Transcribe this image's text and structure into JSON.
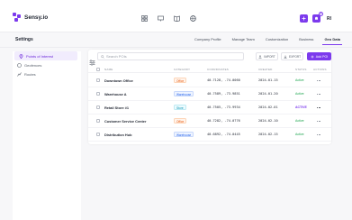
{
  "app": {
    "name": "Sensy.io"
  },
  "colors": {
    "accent": "#7c3aed",
    "office": "#ea580c",
    "warehouse": "#2563eb",
    "store": "#0891b2",
    "active": "#16a34a"
  },
  "topbar": {
    "icons": [
      "grid-icon",
      "monitor-icon",
      "book-icon",
      "globe-icon"
    ],
    "notification_count": "1",
    "avatar_initials": "RI"
  },
  "page": {
    "title": "Settings"
  },
  "tabs": [
    {
      "label": "Company Profile",
      "active": false
    },
    {
      "label": "Manage Team",
      "active": false
    },
    {
      "label": "Customization",
      "active": false
    },
    {
      "label": "Business",
      "active": false
    },
    {
      "label": "Geo Data",
      "active": true
    }
  ],
  "sidebar": {
    "items": [
      {
        "label": "Points of Interest",
        "icon": "map-pin-icon",
        "active": true
      },
      {
        "label": "Geofences",
        "icon": "geofence-icon",
        "active": false
      },
      {
        "label": "Routes",
        "icon": "route-icon",
        "active": false
      }
    ]
  },
  "toolbar": {
    "search_placeholder": "Search POIs",
    "search_value": "",
    "import_label": "IMPORT",
    "export_label": "EXPORT",
    "add_label": "Add POI"
  },
  "table": {
    "columns": [
      "NAME",
      "CATEGORY",
      "COORDINATES",
      "CREATED",
      "STATUS",
      "ACTIONS"
    ],
    "rows": [
      {
        "name": "Downtown Office",
        "category": "Office",
        "category_type": "office",
        "coords": "40.7128, -74.0060",
        "created": "2024-01-15",
        "status": "Active",
        "selected": false
      },
      {
        "name": "Warehouse A",
        "category": "Warehouse",
        "category_type": "warehouse",
        "coords": "40.7589, -73.9851",
        "created": "2024-01-20",
        "status": "Active",
        "selected": false
      },
      {
        "name": "Retail Store #1",
        "category": "Store",
        "category_type": "store",
        "coords": "40.7505, -73.9934",
        "created": "2024-02-01",
        "status": "ACTIVE",
        "selected": true
      },
      {
        "name": "Customer Service Center",
        "category": "Office",
        "category_type": "office",
        "coords": "40.7282, -74.0776",
        "created": "2024-02-10",
        "status": "Active",
        "selected": false
      },
      {
        "name": "Distribution Hub",
        "category": "Warehouse",
        "category_type": "warehouse",
        "coords": "40.6892, -74.0445",
        "created": "2024-02-15",
        "status": "Active",
        "selected": false
      }
    ]
  }
}
